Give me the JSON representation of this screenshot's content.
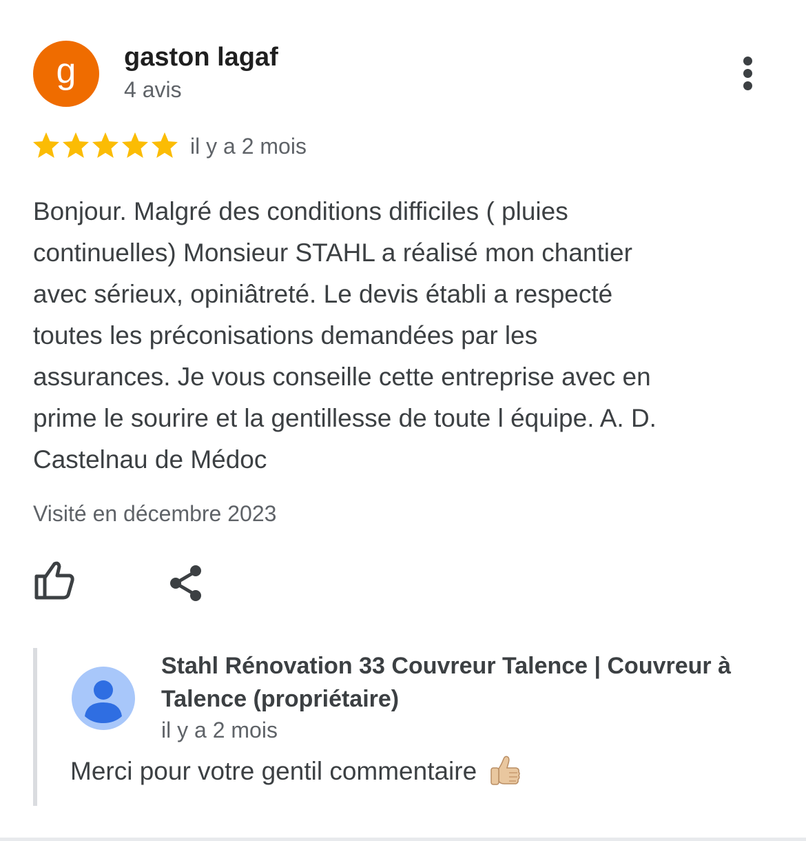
{
  "review": {
    "author": {
      "avatar_letter": "g",
      "avatar_color": "#ef6c00",
      "name": "gaston lagaf",
      "review_count": "4 avis"
    },
    "more_icon": "more-vert-icon",
    "rating": 5,
    "rating_max": 5,
    "star_color": "#fbbc04",
    "date": "il y a 2 mois",
    "text_lines": [
      "Bonjour. Malgré des conditions difficiles ( pluies",
      "continuelles) Monsieur STAHL a réalisé mon chantier",
      "avec sérieux, opiniâtreté. Le devis établi a respecté",
      "toutes les préconisations demandées par les",
      "assurances. Je vous conseille cette entreprise avec en",
      "prime le sourire et la gentillesse de toute l équipe. A. D.",
      "Castelnau de Médoc"
    ],
    "visited": "Visité en décembre 2023",
    "actions": {
      "like_icon": "thumb-up-icon",
      "share_icon": "share-icon"
    }
  },
  "owner_response": {
    "avatar_icon": "person-icon",
    "avatar_color": "#a8c7fa",
    "name_lines": [
      "Stahl Rénovation 33 Couvreur Talence | Couvreur à",
      "Talence (propriétaire)"
    ],
    "date": "il y a 2 mois",
    "text": "Merci pour votre gentil commentaire",
    "emoji_icon": "thumbs-up-emoji-icon"
  }
}
